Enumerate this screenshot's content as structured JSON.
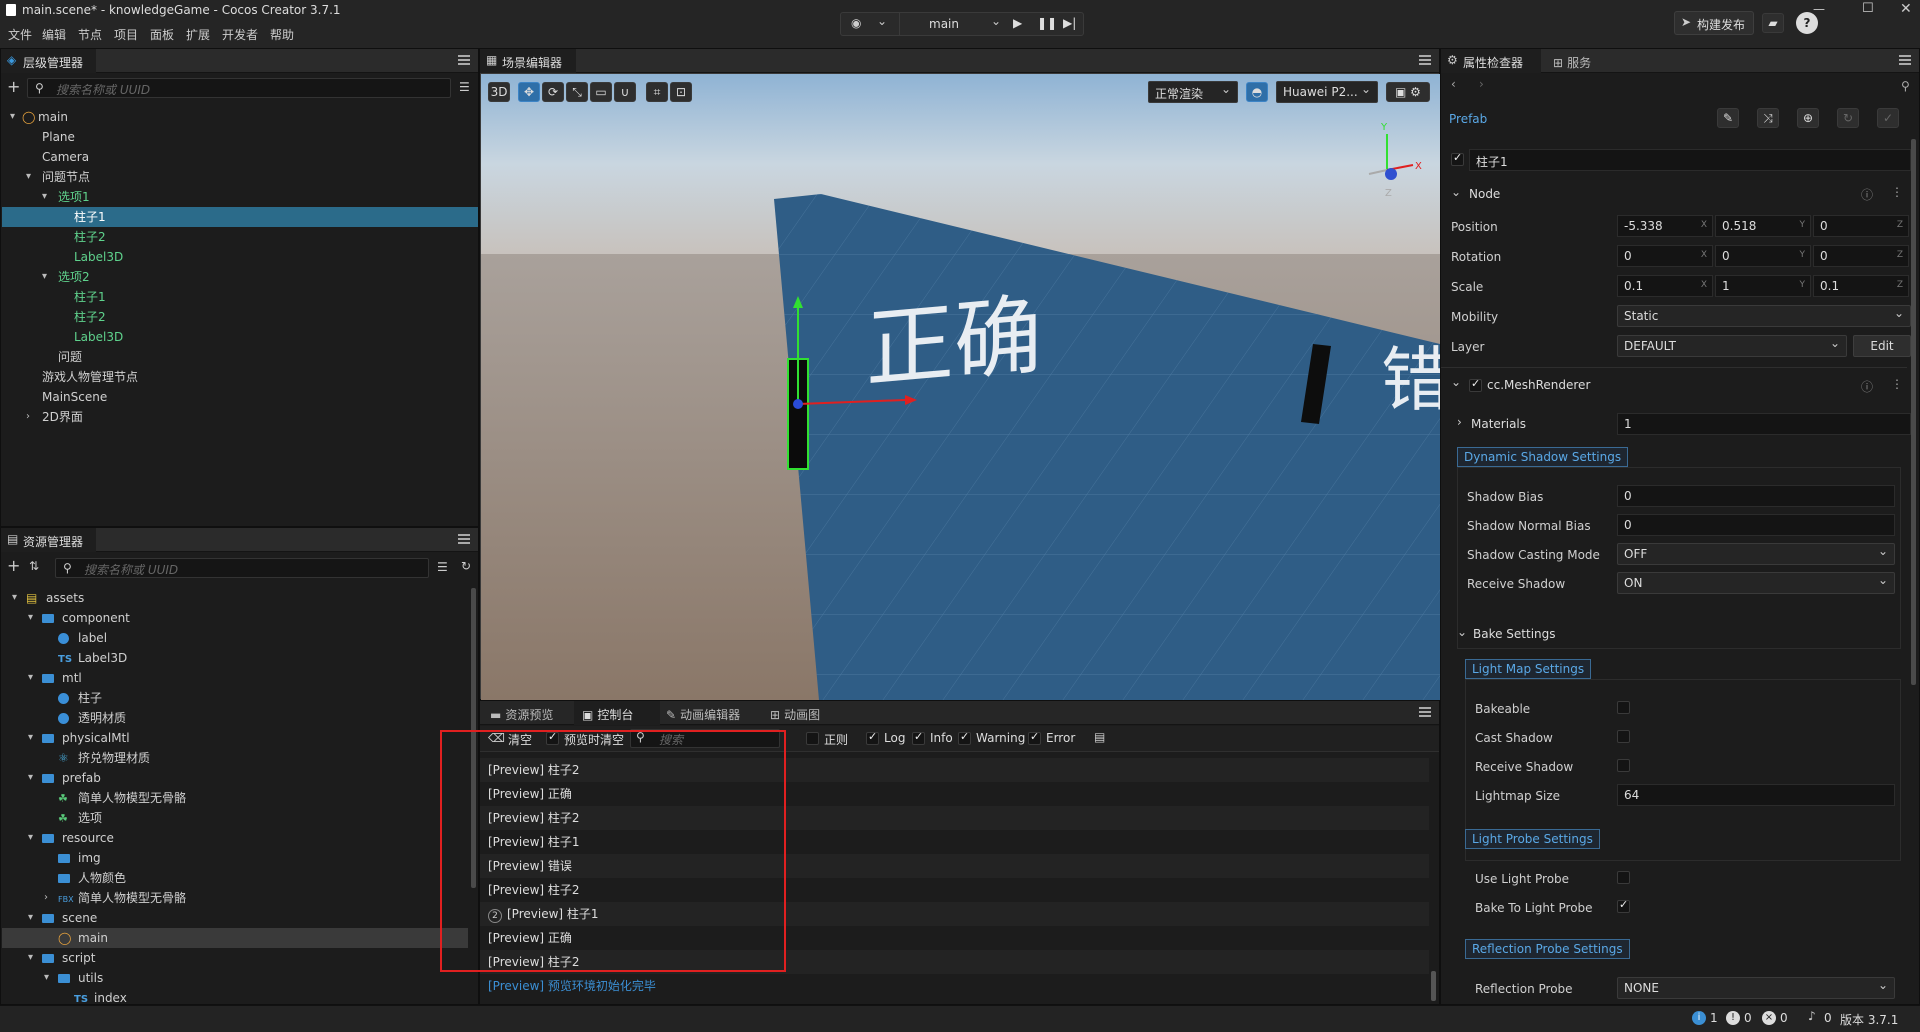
{
  "window": {
    "title": "main.scene* - knowledgeGame - Cocos Creator 3.7.1"
  },
  "menu": [
    "文件",
    "编辑",
    "节点",
    "项目",
    "面板",
    "扩展",
    "开发者",
    "帮助"
  ],
  "toolbar": {
    "scene_select": "main",
    "build_label": "构建发布"
  },
  "hierarchy": {
    "tab": "层级管理器",
    "search_placeholder": "搜索名称或 UUID",
    "nodes": [
      {
        "label": "main",
        "indent": 0,
        "caret": "▾",
        "scene": true
      },
      {
        "label": "Plane",
        "indent": 1
      },
      {
        "label": "Camera",
        "indent": 1
      },
      {
        "label": "问题节点",
        "indent": 1,
        "caret": "▾"
      },
      {
        "label": "选项1",
        "indent": 2,
        "caret": "▾",
        "green": true
      },
      {
        "label": "柱子1",
        "indent": 3,
        "green": true,
        "selected": true
      },
      {
        "label": "柱子2",
        "indent": 3,
        "green": true
      },
      {
        "label": "Label3D",
        "indent": 3,
        "green": true
      },
      {
        "label": "选项2",
        "indent": 2,
        "caret": "▾",
        "green": true
      },
      {
        "label": "柱子1",
        "indent": 3,
        "green": true
      },
      {
        "label": "柱子2",
        "indent": 3,
        "green": true
      },
      {
        "label": "Label3D",
        "indent": 3,
        "green": true
      },
      {
        "label": "问题",
        "indent": 2
      },
      {
        "label": "游戏人物管理节点",
        "indent": 1
      },
      {
        "label": "MainScene",
        "indent": 1
      },
      {
        "label": "2D界面",
        "indent": 1,
        "caret": "›"
      }
    ]
  },
  "assets": {
    "tab": "资源管理器",
    "search_placeholder": "搜索名称或 UUID",
    "items": [
      {
        "label": "assets",
        "indent": 0,
        "caret": "▾",
        "icon": "db"
      },
      {
        "label": "component",
        "indent": 1,
        "caret": "▾",
        "icon": "folder"
      },
      {
        "label": "label",
        "indent": 2,
        "icon": "globe"
      },
      {
        "label": "Label3D",
        "indent": 2,
        "icon": "ts"
      },
      {
        "label": "mtl",
        "indent": 1,
        "caret": "▾",
        "icon": "folder"
      },
      {
        "label": "柱子",
        "indent": 2,
        "icon": "globe"
      },
      {
        "label": "透明材质",
        "indent": 2,
        "icon": "globe"
      },
      {
        "label": "physicalMtl",
        "indent": 1,
        "caret": "▾",
        "icon": "folder"
      },
      {
        "label": "挤兑物理材质",
        "indent": 2,
        "icon": "physics"
      },
      {
        "label": "prefab",
        "indent": 1,
        "caret": "▾",
        "icon": "folder"
      },
      {
        "label": "简单人物模型无骨骼",
        "indent": 2,
        "icon": "prefab"
      },
      {
        "label": "选项",
        "indent": 2,
        "icon": "prefab"
      },
      {
        "label": "resource",
        "indent": 1,
        "caret": "▾",
        "icon": "folder"
      },
      {
        "label": "img",
        "indent": 2,
        "icon": "folder"
      },
      {
        "label": "人物颜色",
        "indent": 2,
        "icon": "folder"
      },
      {
        "label": "简单人物模型无骨骼",
        "indent": 2,
        "caret": "›",
        "icon": "fbx"
      },
      {
        "label": "scene",
        "indent": 1,
        "caret": "▾",
        "icon": "folder"
      },
      {
        "label": "main",
        "indent": 2,
        "icon": "scene",
        "selected": true
      },
      {
        "label": "script",
        "indent": 1,
        "caret": "▾",
        "icon": "folder"
      },
      {
        "label": "utils",
        "indent": 2,
        "caret": "▾",
        "icon": "folder"
      },
      {
        "label": "index",
        "indent": 3,
        "icon": "ts"
      }
    ]
  },
  "scene_editor": {
    "tab": "场景编辑器",
    "mode_3d": "3D",
    "render_mode": "正常渲染",
    "device": "Huawei P2...",
    "scene_text_1": "正确",
    "scene_text_2": "错"
  },
  "console": {
    "tabs": [
      "资源预览",
      "控制台",
      "动画编辑器",
      "动画图"
    ],
    "active_tab": 1,
    "clear_label": "清空",
    "clear_on_preview_label": "预览时清空",
    "search_placeholder": "搜索",
    "filters": {
      "regex": "正则",
      "log": "Log",
      "info": "Info",
      "warning": "Warning",
      "error": "Error"
    },
    "logs": [
      {
        "text": "[Preview] 柱子2"
      },
      {
        "text": "[Preview] 正确"
      },
      {
        "text": "[Preview] 柱子2"
      },
      {
        "text": "[Preview] 柱子1"
      },
      {
        "text": "[Preview] 错误"
      },
      {
        "text": "[Preview] 柱子2"
      },
      {
        "text": "[Preview] 柱子1",
        "count": "2"
      },
      {
        "text": "[Preview] 正确"
      },
      {
        "text": "[Preview] 柱子2"
      },
      {
        "text": "[Preview] 预览环境初始化完毕",
        "info": true
      }
    ],
    "highlight_color": "#e02020"
  },
  "inspector": {
    "tabs": [
      "属性检查器",
      "服务"
    ],
    "asset_type": "Prefab",
    "node_name": "柱子1",
    "node_section": "Node",
    "position": {
      "label": "Position",
      "x": "-5.338",
      "y": "0.518",
      "z": "0"
    },
    "rotation": {
      "label": "Rotation",
      "x": "0",
      "y": "0",
      "z": "0"
    },
    "scale": {
      "label": "Scale",
      "x": "0.1",
      "y": "1",
      "z": "0.1"
    },
    "mobility": {
      "label": "Mobility",
      "value": "Static"
    },
    "layer": {
      "label": "Layer",
      "value": "DEFAULT",
      "edit": "Edit"
    },
    "mesh_renderer": "cc.MeshRenderer",
    "materials": {
      "label": "Materials",
      "value": "1"
    },
    "dynamic_shadow": "Dynamic Shadow Settings",
    "shadow_bias": {
      "label": "Shadow Bias",
      "value": "0"
    },
    "shadow_normal_bias": {
      "label": "Shadow Normal Bias",
      "value": "0"
    },
    "shadow_casting": {
      "label": "Shadow Casting Mode",
      "value": "OFF"
    },
    "receive_shadow": {
      "label": "Receive Shadow",
      "value": "ON"
    },
    "bake_settings": "Bake Settings",
    "light_map": "Light Map Settings",
    "bakeable": "Bakeable",
    "cast_shadow": "Cast Shadow",
    "receive_shadow2": "Receive Shadow",
    "lightmap_size": {
      "label": "Lightmap Size",
      "value": "64"
    },
    "light_probe": "Light Probe Settings",
    "use_light_probe": "Use Light Probe",
    "bake_to_light_probe": "Bake To Light Probe",
    "reflection_probe_settings": "Reflection Probe Settings",
    "reflection_probe": {
      "label": "Reflection Probe",
      "value": "NONE"
    }
  },
  "statusbar": {
    "info": "1",
    "warn": "0",
    "error": "0",
    "notify": "0",
    "version": "版本 3.7.1"
  }
}
